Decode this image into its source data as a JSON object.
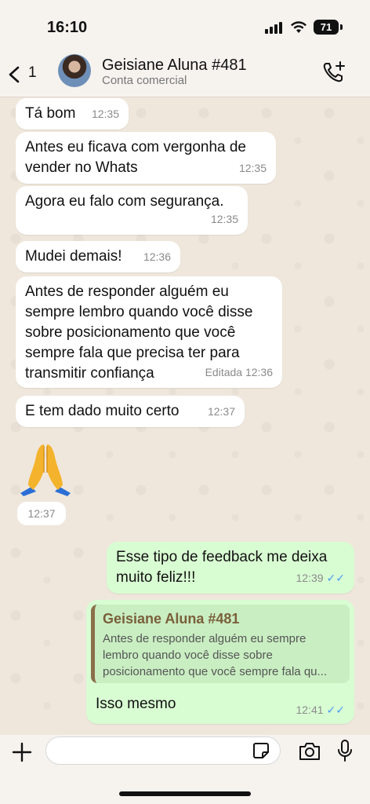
{
  "status": {
    "time": "16:10",
    "battery": "71"
  },
  "header": {
    "back_count": "1",
    "contact_name": "Geisiane Aluna #481",
    "contact_subtitle": "Conta comercial"
  },
  "messages": [
    {
      "text": "Tá bom",
      "time": "12:35"
    },
    {
      "text": "Antes eu ficava com vergonha de vender no Whats",
      "time": "12:35"
    },
    {
      "text": "Agora eu falo com segurança.",
      "time": "12:35"
    },
    {
      "text": "Mudei demais!",
      "time": "12:36"
    },
    {
      "text": "Antes de responder alguém eu sempre lembro quando você disse sobre posicionamento que você sempre fala que precisa ter para transmitir confiança",
      "time": "Editada 12:36"
    },
    {
      "text": "E tem dado muito certo",
      "time": "12:37"
    }
  ],
  "emoji_message": {
    "emoji": "praying-hands",
    "time": "12:37"
  },
  "outgoing": [
    {
      "text": "Esse tipo de feedback me deixa muito feliz!!!",
      "time": "12:39"
    }
  ],
  "reply": {
    "quoted_name": "Geisiane Aluna #481",
    "quoted_text": "Antes de responder alguém eu sempre lembro quando você disse sobre posicionamento que você sempre fala qu...",
    "text": "Isso mesmo",
    "time": "12:41"
  },
  "input": {
    "placeholder": ""
  },
  "colors": {
    "outgoing_bubble": "#d9fdd3",
    "incoming_bubble": "#ffffff",
    "read_ticks": "#4a9af0",
    "quote_name": "#7a5f3a"
  }
}
